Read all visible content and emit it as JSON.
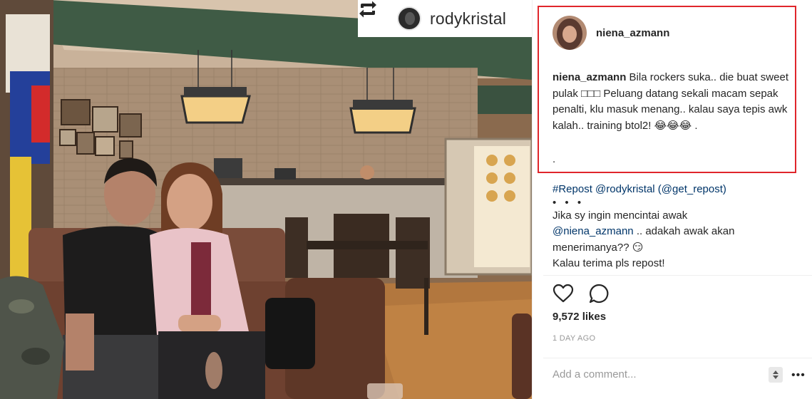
{
  "repost_badge": {
    "username": "rodykristal",
    "icon": "repost-icon"
  },
  "post": {
    "author": "niena_azmann",
    "caption_user": "niena_azmann",
    "caption_text": "Bila rockers suka.. die buat sweet pulak □□□ Peluang datang sekali macam sepak penalti, klu masuk menang.. kalau saya tepis awk kalah.. training btol2! 😂😂😂 .",
    "caption_dot": ".",
    "repost_line": {
      "hashtag": "#Repost",
      "mention": "@rodykristal",
      "via": "(@get_repost)"
    },
    "dots": "• • •",
    "comment_line1": "Jika sy ingin mencintai awak",
    "comment_mention": "@niena_azmann",
    "comment_line2": ".. adakah awak akan",
    "comment_line3": "menerimanya?? 😏",
    "comment_line4": "Kalau terima pls repost!",
    "likes": "9,572 likes",
    "time_ago": "1 DAY AGO",
    "add_comment_placeholder": "Add a comment...",
    "more_label": "•••"
  },
  "icons": {
    "like": "heart-icon",
    "comment": "comment-icon",
    "stepper": "stepper-icon"
  },
  "colors": {
    "highlight": "#e0262b",
    "link": "#003569",
    "muted": "#999999"
  }
}
